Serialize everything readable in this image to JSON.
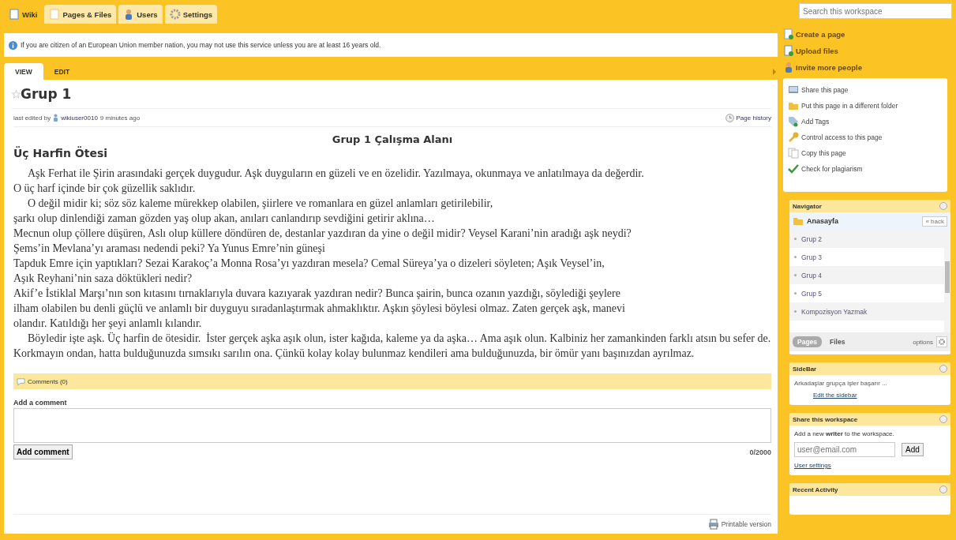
{
  "top_tabs": [
    {
      "label": "Wiki",
      "kind": "wiki",
      "selected": true
    },
    {
      "label": "Pages & Files",
      "kind": "pages",
      "selected": false
    },
    {
      "label": "Users",
      "kind": "users",
      "selected": false
    },
    {
      "label": "Settings",
      "kind": "settings",
      "selected": false
    }
  ],
  "search": {
    "placeholder": "Search this workspace"
  },
  "notice": "If you are citizen of an European Union member nation, you may not use this service unless you are at least 16 years old.",
  "view_tabs": [
    {
      "label": "VIEW",
      "selected": true
    },
    {
      "label": "EDIT",
      "selected": false
    }
  ],
  "page": {
    "title": "Grup 1",
    "starred": false,
    "edited_prefix": "last edited by",
    "edited_user": "wikiuser0010",
    "edited_time": "9 minutes ago",
    "history": "Page history",
    "heading_center": "Grup 1 Çalışma Alanı",
    "heading": "Üç Harfin Ötesi",
    "lines": [
      {
        "text": "Aşk Ferhat ile Şirin arasındaki gerçek duygudur. Aşk duyguların en güzeli ve en özelidir. Yazılmaya, okunmaya ve anlatılmaya da değerdir.",
        "indent": true
      },
      {
        "text": "O üç harf içinde bir çok güzellik saklıdır.",
        "indent": false
      },
      {
        "text": "O değil midir ki; söz söz kaleme mürekkep olabilen, şiirlere ve romanlara en güzel anlamları getirilebilir,",
        "indent": true
      },
      {
        "text": "şarkı olup dinlendiği zaman gözden yaş olup akan, anıları canlandırıp sevdiğini getirir aklına…",
        "indent": false
      },
      {
        "text": "Mecnun olup çöllere düşüren, Aslı olup küllere döndüren de, destanlar yazdıran da yine o değil midir? Veysel Karani’nin aradığı aşk neydi?",
        "indent": false
      },
      {
        "text": "Şems’in Mevlana’yı araması nedendi peki? Ya Yunus Emre’nin güneşi",
        "indent": false
      },
      {
        "text": "Tapduk Emre için yaptıkları? Sezai Karakoç’a Monna Rosa’yı yazdıran mesela? Cemal Süreya’ya o dizeleri söyleten; Aşık Veysel’in,",
        "indent": false
      },
      {
        "text": "Aşık Reyhani’nin saza döktükleri nedir?",
        "indent": false
      },
      {
        "text": "Akif’e İstiklal Marşı’nın son kıtasını tırnaklarıyla duvara kazıyarak yazdıran nedir? Bunca şairin, bunca ozanın yazdığı, söylediği şeylere",
        "indent": false
      },
      {
        "text": "ilham olabilen bu denli güçlü ve anlamlı bir duyguyu sıradanlaştırmak ahmaklıktır. Aşkın şöylesi böylesi olmaz. Zaten gerçek aşk, manevi",
        "indent": false
      },
      {
        "text": "olandır. Katıldığı her şeyi anlamlı kılandır.",
        "indent": false
      },
      {
        "text": "Böyledir işte aşk. Üç harfin de ötesidir.  İster gerçek aşka aşık olun, ister kağıda, kaleme ya da aşka… Ama aşık olun. Kalbiniz her zamankinden farklı atsın bu sefer de.",
        "indent": true
      },
      {
        "text": "Korkmayın ondan, hatta bulduğunuzda sımsıkı sarılın ona. Çünkü kolay kolay bulunmaz kendileri ama bulduğunuzda, bir ömür yanı başınızdan ayrılmaz.",
        "indent": false
      }
    ],
    "comments": "Comments (0)",
    "add_label": "Add a comment",
    "add_button": "Add comment",
    "counter": "0/2000",
    "printable": "Printable version"
  },
  "quick_links": [
    {
      "label": "Create a page",
      "kind": "page"
    },
    {
      "label": "Upload files",
      "kind": "upload"
    },
    {
      "label": "Invite more people",
      "kind": "person"
    }
  ],
  "actions": [
    {
      "label": "Share this page",
      "kind": "share"
    },
    {
      "label": "Put this page in a different folder",
      "kind": "folder"
    },
    {
      "label": "Add Tags",
      "kind": "tag"
    },
    {
      "label": "Control access to this page",
      "kind": "key"
    },
    {
      "label": "Copy this page",
      "kind": "copy"
    },
    {
      "label": "Check for plagiarism",
      "kind": "check"
    }
  ],
  "navigator": {
    "title": "Navigator",
    "folder": "Anasayfa",
    "back": "« back",
    "items": [
      "Grup 2",
      "Grup 3",
      "Grup 4",
      "Grup 5",
      "Kompozisyon Yazmak"
    ],
    "tabs": [
      {
        "label": "Pages",
        "selected": true
      },
      {
        "label": "Files",
        "selected": false
      }
    ],
    "options": "options"
  },
  "sidebar": {
    "title": "SideBar",
    "text": "Arkadaşlar grupça işler başarır ...",
    "link": "Edit the sidebar"
  },
  "share": {
    "title": "Share this workspace",
    "text": "Add a new **writer** to the workspace.",
    "placeholder": "user@email.com",
    "button": "Add",
    "link": "User settings"
  },
  "recent": {
    "title": "Recent Activity"
  }
}
